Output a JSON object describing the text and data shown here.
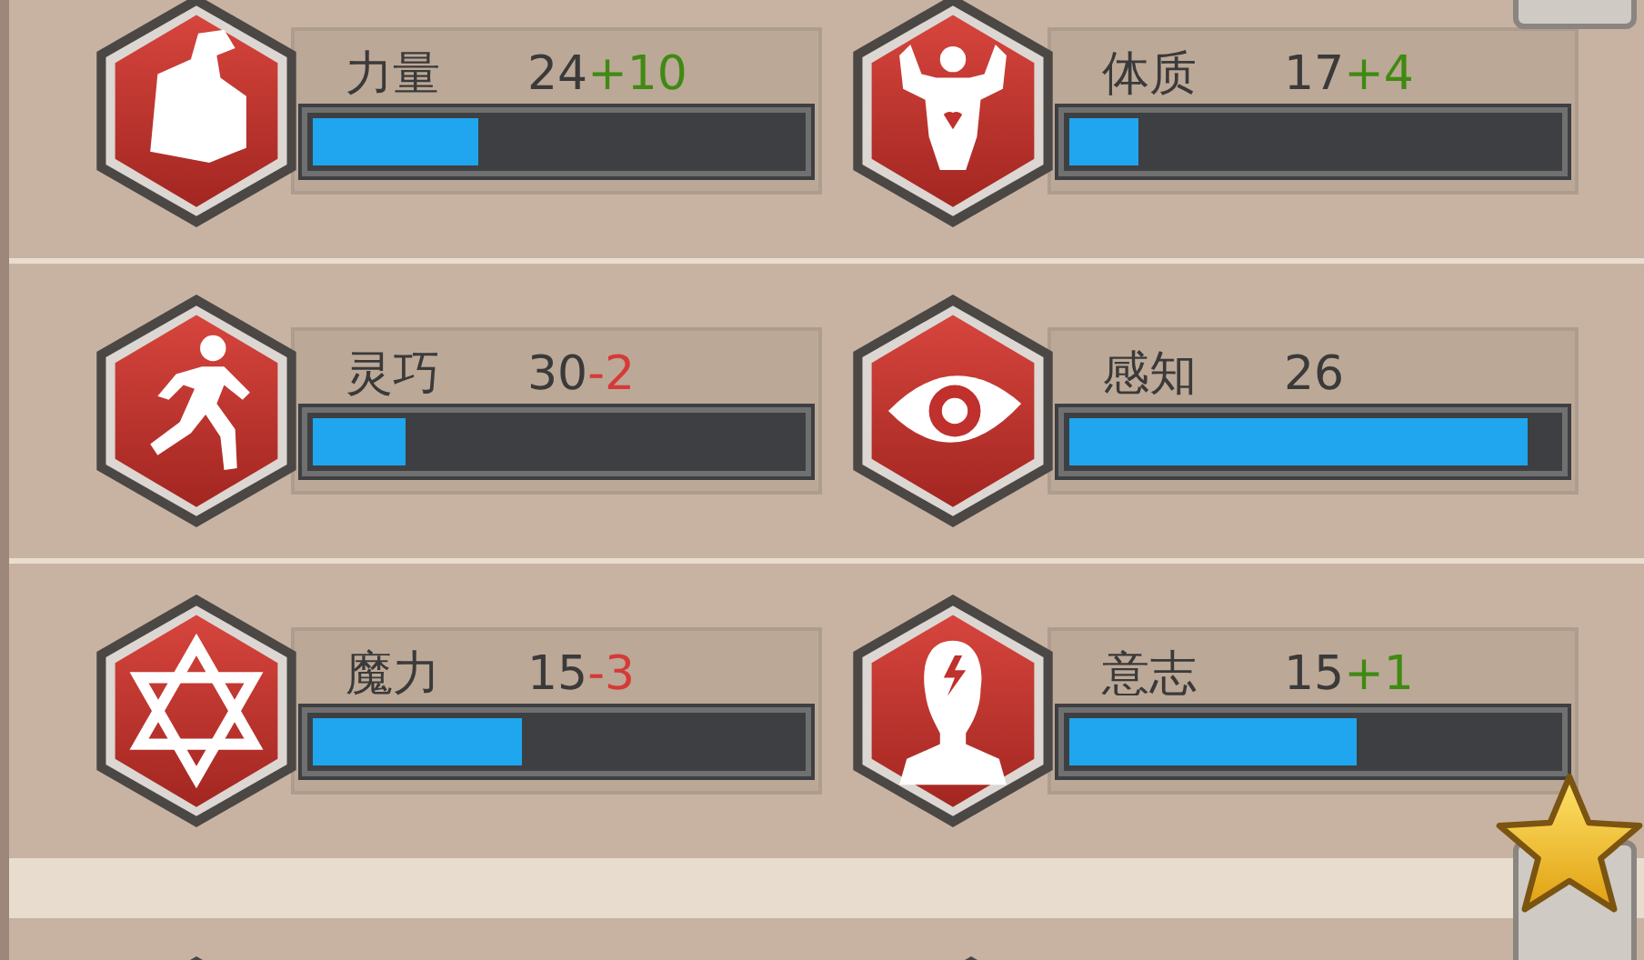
{
  "stats": [
    {
      "name": "力量",
      "base": "24",
      "bonus": {
        "text": "+10",
        "kind": "gain"
      },
      "level": 0.34
    },
    {
      "name": "体质",
      "base": "17",
      "bonus": {
        "text": "+4",
        "kind": "gain"
      },
      "level": 0.14
    },
    {
      "name": "灵巧",
      "base": "30",
      "bonus": {
        "text": "-2",
        "kind": "loss"
      },
      "level": 0.19
    },
    {
      "name": "感知",
      "base": "26",
      "level": 0.94
    },
    {
      "name": "魔力",
      "base": "15",
      "bonus": {
        "text": "-3",
        "kind": "loss"
      },
      "level": 0.43
    },
    {
      "name": "意志",
      "base": "15",
      "bonus": {
        "text": "+1",
        "kind": "gain"
      },
      "level": 0.59
    }
  ]
}
